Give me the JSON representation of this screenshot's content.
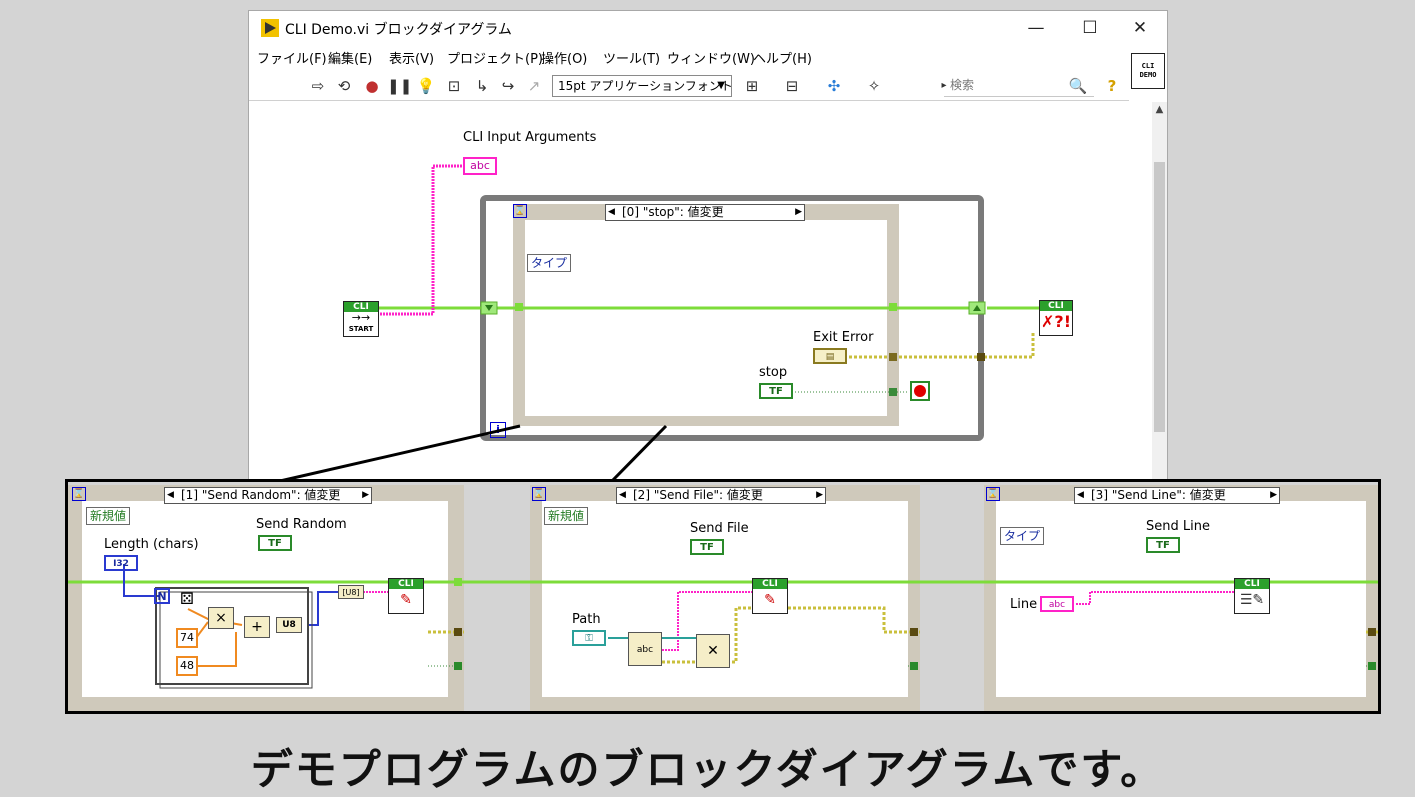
{
  "window": {
    "title": "CLI Demo.vi ブロックダイアグラム",
    "minimize": "—",
    "maximize": "☐",
    "close": "✕"
  },
  "menu": [
    "ファイル(F)",
    "編集(E)",
    "表示(V)",
    "プロジェクト(P)",
    "操作(O)",
    "ツール(T)",
    "ウィンドウ(W)",
    "ヘルプ(H)"
  ],
  "toolbar": {
    "font": "15pt アプリケーションフォント",
    "search_placeholder": "検索",
    "vi_icon_line1": "CLI",
    "vi_icon_line2": "DEMO"
  },
  "diagram": {
    "cli_input_label": "CLI Input Arguments",
    "abc_tag": "abc",
    "start_top": "CLI",
    "start_bottom": "START",
    "stop_node_top": "CLI",
    "event_case_selector": "[0] \"stop\": 値変更",
    "type_node": "タイプ",
    "exit_error_label": "Exit Error",
    "stop_label": "stop",
    "tf": "TF",
    "iteration": "i",
    "hourglass": "⌛"
  },
  "cases": [
    {
      "selector": "[1] \"Send Random\": 値変更",
      "new_val": "新規値",
      "button_label": "Send Random",
      "length_label": "Length (chars)",
      "i32": "I32",
      "n": "N",
      "const_74": "74",
      "const_48": "48",
      "u8": "U8",
      "u8b": "[U8]",
      "cli": "CLI"
    },
    {
      "selector": "[2] \"Send File\": 値変更",
      "new_val": "新規値",
      "button_label": "Send File",
      "path_label": "Path",
      "abc": "abc",
      "cli": "CLI"
    },
    {
      "selector": "[3] \"Send Line\": 値変更",
      "type_node": "タイプ",
      "button_label": "Send Line",
      "line_label": "Line",
      "abc": "abc",
      "cli": "CLI"
    }
  ],
  "caption": "デモプログラムのブロックダイアグラムです。",
  "colors": {
    "wire_green": "#7ddc3a",
    "wire_pink": "#ff22c8",
    "wire_error": "#c9bf3c",
    "border_blue": "#0000d0"
  }
}
